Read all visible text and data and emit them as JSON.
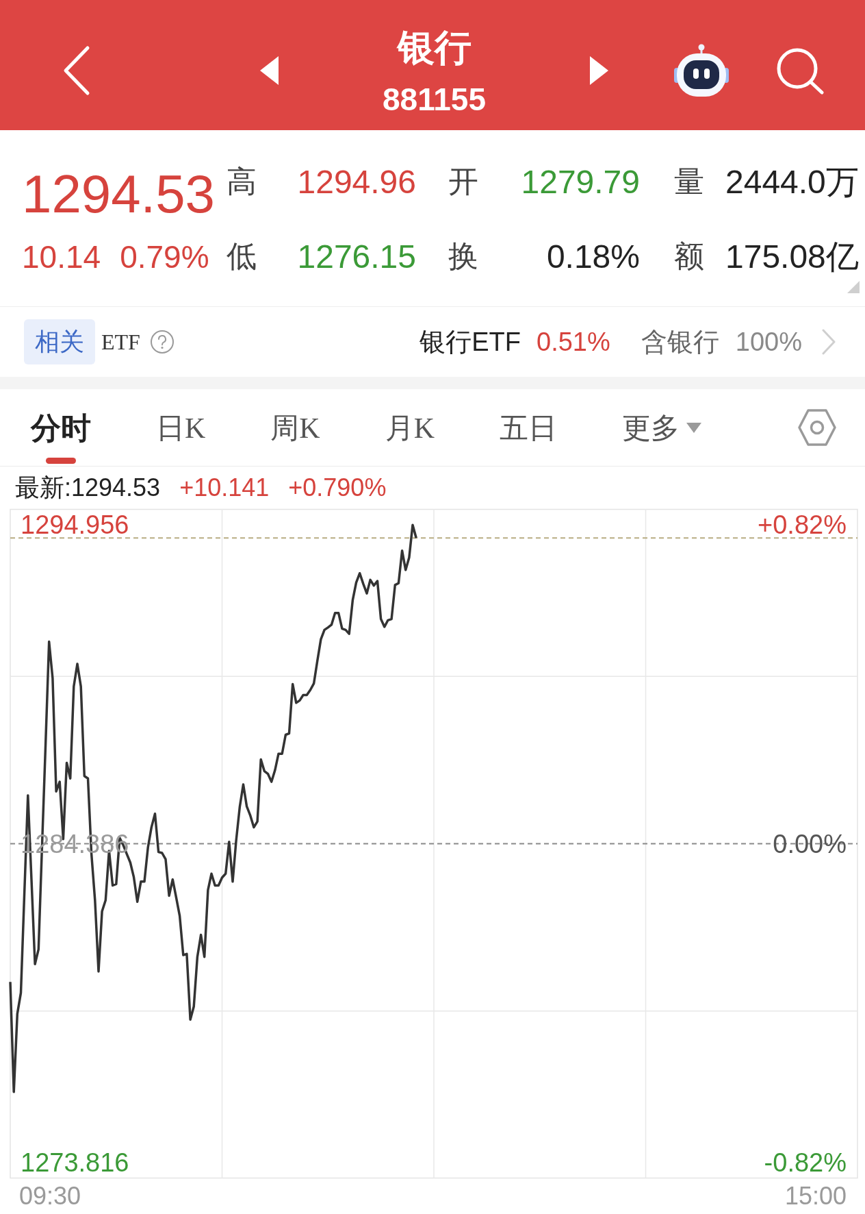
{
  "header": {
    "title": "银行",
    "code": "881155"
  },
  "quote": {
    "price": {
      "text": "1294.53",
      "color": "#d6433d"
    },
    "change": {
      "text": "10.14",
      "color": "#d6433d"
    },
    "change_pct": {
      "text": "0.79%",
      "color": "#d6433d"
    },
    "stats": [
      {
        "label": "高",
        "value": "1294.96",
        "color": "#d6433d"
      },
      {
        "label": "开",
        "value": "1279.79",
        "color": "#3b9a37"
      },
      {
        "label": "量",
        "value": "2444.0万",
        "color": "#222222"
      },
      {
        "label": "低",
        "value": "1276.15",
        "color": "#3b9a37"
      },
      {
        "label": "换",
        "value": "0.18%",
        "color": "#222222"
      },
      {
        "label": "额",
        "value": "175.08亿",
        "color": "#222222"
      }
    ]
  },
  "etf": {
    "tag": "相关",
    "label": "ETF",
    "fund": "银行ETF",
    "fund_change": {
      "text": "0.51%",
      "color": "#d6433d"
    },
    "holding_label": "含银行",
    "holding": "100%"
  },
  "tabs": [
    {
      "label": "分时",
      "selected": true,
      "kind": "plain"
    },
    {
      "label": "日K",
      "selected": false,
      "kind": "plain"
    },
    {
      "label": "周K",
      "selected": false,
      "kind": "plain"
    },
    {
      "label": "月K",
      "selected": false,
      "kind": "plain"
    },
    {
      "label": "五日",
      "selected": false,
      "kind": "plain"
    },
    {
      "label": "更多",
      "selected": false,
      "kind": "menu"
    }
  ],
  "legend": {
    "label": "最新:1294.53",
    "change": {
      "text": "+10.141",
      "color": "#d6433d"
    },
    "change_pct": {
      "text": "+0.790%",
      "color": "#d6433d"
    }
  },
  "chart": {
    "chart_data": {
      "type": "line",
      "categories": [
        null,
        null,
        null,
        null,
        null,
        null,
        null,
        null,
        null,
        null,
        null,
        null,
        null,
        null,
        null,
        null,
        null,
        null,
        null,
        null,
        null,
        null,
        null,
        null,
        null,
        null,
        null,
        null,
        null,
        null,
        null,
        null,
        null,
        null,
        null,
        null,
        null,
        null,
        null,
        null,
        null,
        null,
        null,
        null,
        null,
        null,
        null,
        null,
        null,
        null,
        null,
        null,
        null,
        null,
        null,
        null,
        null,
        null,
        null,
        null,
        null,
        null,
        null,
        null,
        null,
        null,
        null,
        null,
        null,
        null,
        null,
        null,
        null,
        null,
        null,
        null,
        null,
        null,
        null,
        null,
        null,
        null,
        null,
        null,
        null,
        null,
        null,
        null,
        null,
        null,
        null,
        null,
        null,
        null,
        null,
        null,
        null,
        null,
        null,
        null,
        null,
        null,
        null,
        null,
        null,
        null,
        null,
        null,
        null,
        null,
        null,
        null,
        null,
        null,
        null,
        null,
        null,
        null,
        null,
        null,
        null,
        null,
        null,
        null,
        null,
        null,
        null,
        null,
        null,
        null,
        null,
        null,
        null,
        null,
        null,
        null,
        null,
        null,
        null,
        null,
        null,
        null,
        null,
        null,
        null,
        null,
        null,
        null,
        null,
        null,
        null,
        null,
        null,
        null,
        null,
        null,
        null,
        null,
        null,
        null,
        null,
        null,
        null,
        null,
        null,
        null,
        null,
        null,
        null,
        null,
        null,
        null,
        null,
        null,
        null,
        null,
        null,
        null,
        null,
        null,
        null,
        null,
        null,
        null,
        null,
        null,
        null,
        null,
        null,
        null,
        null,
        null,
        null,
        null,
        null,
        null,
        null,
        null,
        null,
        null,
        null,
        null,
        null,
        null,
        null,
        null,
        null,
        null,
        null,
        null,
        null,
        null,
        null,
        null,
        null,
        null,
        null,
        null,
        null,
        null,
        null,
        null,
        null,
        null,
        null,
        null,
        null,
        null,
        null,
        null,
        null,
        null,
        null,
        null,
        null,
        null,
        null,
        null,
        null,
        null,
        null
      ],
      "series": [
        {
          "color": "#333333",
          "values": [
            1279.8,
            1276.15,
            1278.74,
            1279.44,
            1282.72,
            1285.99,
            1283.19,
            1280.39,
            1280.88,
            1284.28,
            1287.68,
            1291.09,
            1289.88,
            1286.12,
            1286.44,
            1284.54,
            1287.07,
            1286.55,
            1289.6,
            1290.35,
            1289.6,
            1286.63,
            1286.55,
            1284.06,
            1282.51,
            1280.15,
            1282.14,
            1282.51,
            1284.15,
            1283.0,
            1283.05,
            1284.58,
            1284.34,
            1284.05,
            1283.76,
            1283.28,
            1282.46,
            1283.13,
            1283.13,
            1284.26,
            1284.93,
            1285.38,
            1284.11,
            1284.08,
            1283.87,
            1282.66,
            1283.2,
            1282.61,
            1281.99,
            1280.69,
            1280.73,
            1278.55,
            1278.98,
            1280.63,
            1281.36,
            1280.63,
            1282.85,
            1283.39,
            1283.0,
            1283.0,
            1283.26,
            1283.39,
            1284.45,
            1283.13,
            1284.49,
            1285.6,
            1286.35,
            1285.62,
            1285.32,
            1284.93,
            1285.12,
            1287.18,
            1286.79,
            1286.7,
            1286.44,
            1286.83,
            1287.37,
            1287.37,
            1288.0,
            1288.04,
            1289.68,
            1289.06,
            1289.14,
            1289.32,
            1289.32,
            1289.49,
            1289.7,
            1290.46,
            1291.17,
            1291.48,
            1291.56,
            1291.65,
            1292.04,
            1292.04,
            1291.52,
            1291.48,
            1291.35,
            1292.47,
            1293.05,
            1293.36,
            1293.01,
            1292.69,
            1293.14,
            1292.95,
            1293.1,
            1291.84,
            1291.58,
            1291.8,
            1291.84,
            1292.97,
            1293.03,
            1294.11,
            1293.47,
            1293.88,
            1294.96,
            1294.53,
            null,
            null,
            null,
            null,
            null,
            null,
            null,
            null,
            null,
            null,
            null,
            null,
            null,
            null,
            null,
            null,
            null,
            null,
            null,
            null,
            null,
            null,
            null,
            null,
            null,
            null,
            null,
            null,
            null,
            null,
            null,
            null,
            null,
            null,
            null,
            null,
            null,
            null,
            null,
            null,
            null,
            null,
            null,
            null,
            null,
            null,
            null,
            null,
            null,
            null,
            null,
            null,
            null,
            null,
            null,
            null,
            null,
            null,
            null,
            null,
            null,
            null,
            null,
            null,
            null,
            null,
            null,
            null,
            null,
            null,
            null,
            null,
            null,
            null,
            null,
            null,
            null,
            null,
            null,
            null,
            null,
            null,
            null,
            null,
            null,
            null,
            null,
            null,
            null,
            null,
            null,
            null,
            null,
            null,
            null,
            null,
            null,
            null,
            null,
            null,
            null,
            null,
            null,
            null,
            null,
            null,
            null,
            null,
            null,
            null,
            null,
            null,
            null,
            null,
            null,
            null,
            null,
            null,
            null,
            null,
            null,
            null,
            null,
            null,
            null
          ]
        }
      ],
      "ylim": [
        1273.282,
        1295.49
      ],
      "yticks": [
        {
          "value": 1294.956,
          "label": "1294.956"
        },
        {
          "value": 1284.386,
          "label": "1284.386"
        },
        {
          "value": 1273.816,
          "label": "1273.816"
        }
      ],
      "ref_lines": [
        {
          "axis": "y",
          "value": 1294.53,
          "color": "#b9ad84"
        },
        {
          "axis": "y",
          "value": 1284.386,
          "color": "#8a8a8a"
        }
      ]
    },
    "pct_labels": [
      {
        "text": "+0.82%",
        "color": "#d6433d"
      },
      {
        "text": "0.00%",
        "color": "#555555"
      },
      {
        "text": "-0.82%",
        "color": "#3b9a37"
      }
    ],
    "time_labels": [
      "09:30",
      "15:00"
    ]
  }
}
